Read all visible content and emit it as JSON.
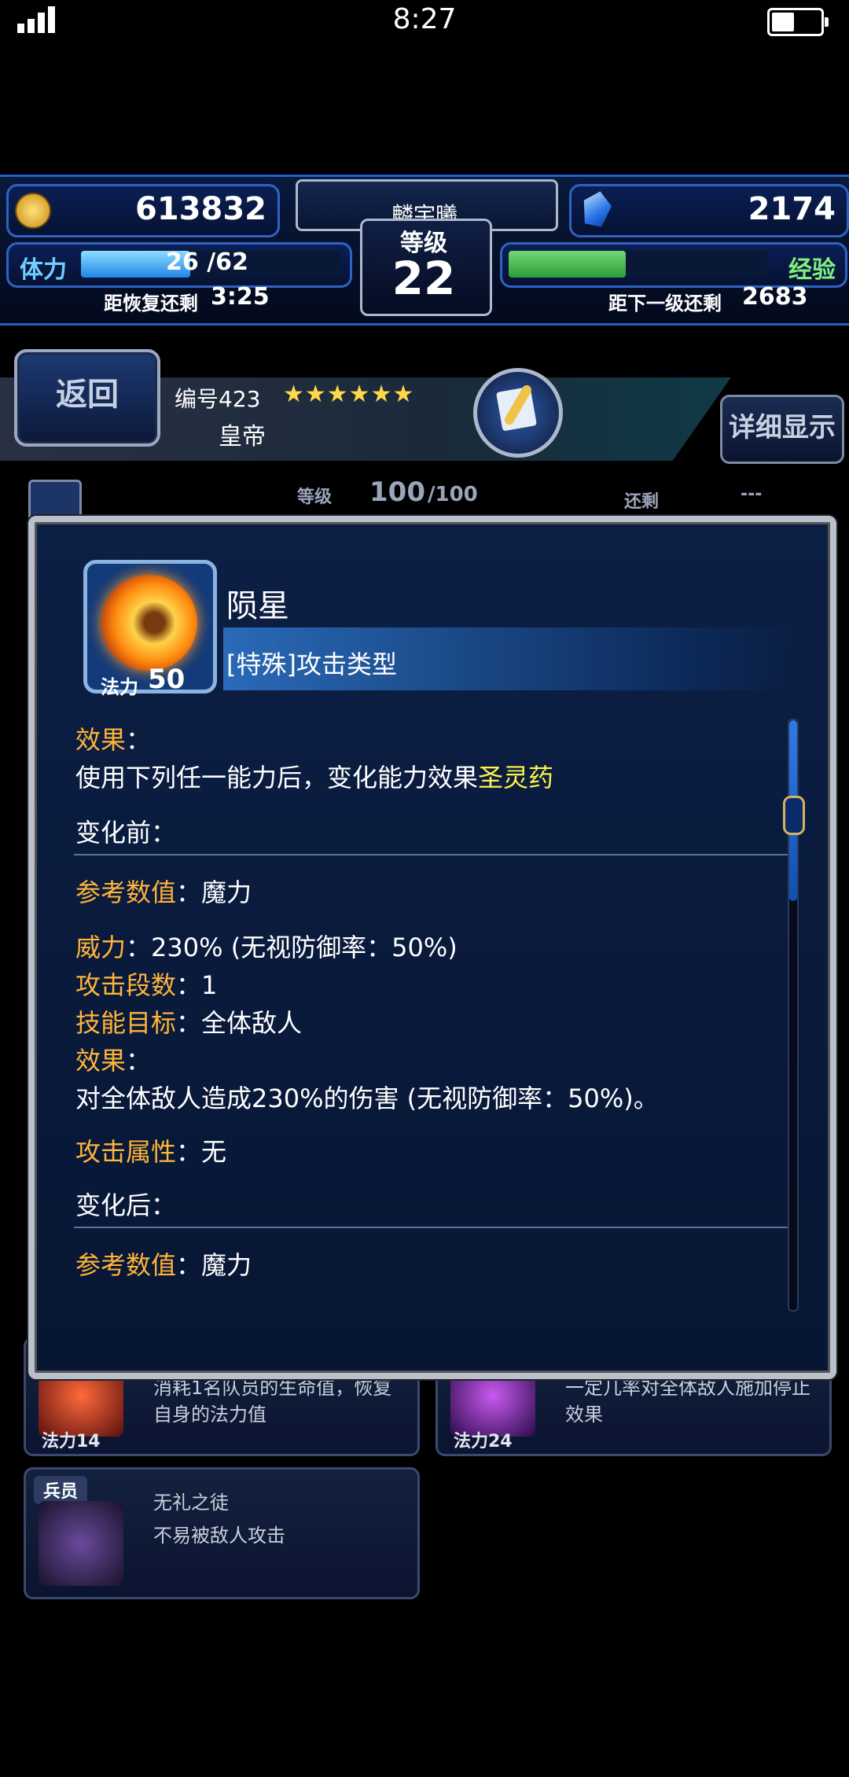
{
  "status": {
    "time": "8:27"
  },
  "header": {
    "gil": "613832",
    "player_name": "麟宇曦",
    "level_label": "等级",
    "level": "22",
    "gems": "2174",
    "stamina_label": "体力",
    "stamina_value": "26 /62",
    "stamina_fraction": 0.42,
    "recover_label": "距恢复还剩",
    "recover_time": "3:25",
    "exp_label": "经验",
    "exp_fraction": 0.45,
    "next_level_label": "距下一级还剩",
    "next_level_value": "2683"
  },
  "unit": {
    "back": "返回",
    "number": "编号423",
    "stars": "★★★★★★",
    "name": "皇帝",
    "detail": "详细显示",
    "level_label": "等级",
    "level_value": "100",
    "level_max": "/100",
    "remain_label": "还剩",
    "remain_value": "---"
  },
  "modal": {
    "ability_name": "陨星",
    "type": "[特殊]攻击类型",
    "mp_label": "法力",
    "mp_value": "50",
    "effect_label": "效果",
    "effect_text_a": "使用下列任一能力后，变化能力效果",
    "effect_text_b": "圣灵药",
    "before_label": "变化前：",
    "ref_label": "参考数值",
    "ref_value": "魔力",
    "power_label": "威力",
    "power_value": "230% (无视防御率：50%)",
    "hits_label": "攻击段数",
    "hits_value": "1",
    "target_label": "技能目标",
    "target_value": "全体敌人",
    "effect2_label": "效果",
    "effect2_text": "对全体敌人造成230%的伤害 (无视防御率：50%)。",
    "element_label": "攻击属性",
    "element_value": "无",
    "after_label": "变化后：",
    "ref2_label": "参考数值",
    "ref2_value": "魔力"
  },
  "cards": {
    "card1_desc_a": "消耗1名队员的生命值，恢复",
    "card1_desc_b": "自身的法力值",
    "card1_mp": "法力14",
    "card2_desc_a": "一定几率对全体敌人施加停止",
    "card2_desc_b": "效果",
    "card2_mp": "法力24",
    "card3_tag": "兵员",
    "card3_title": "无礼之徒",
    "card3_desc": "不易被敌人攻击"
  }
}
